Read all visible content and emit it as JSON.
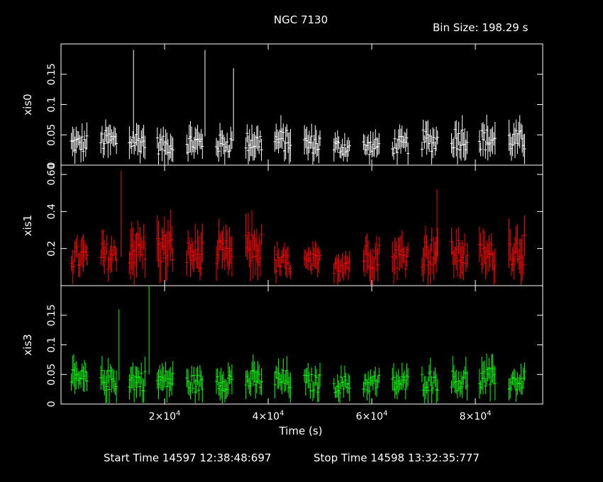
{
  "title": "NGC 7130",
  "bin_size_label": "Bin Size: 198.29 s",
  "footer": {
    "start_label": "Start Time 14597 12:38:48:697",
    "stop_label": "Stop Time 14598 13:32:35:777"
  },
  "chart_data": {
    "type": "line",
    "title": "NGC 7130",
    "xlabel": "Time (s)",
    "xlim": [
      0,
      93000
    ],
    "x_ticks": [
      {
        "value": 20000,
        "base": "2×10",
        "exp": "4"
      },
      {
        "value": 40000,
        "base": "4×10",
        "exp": "4"
      },
      {
        "value": 60000,
        "base": "6×10",
        "exp": "4"
      },
      {
        "value": 80000,
        "base": "8×10",
        "exp": "4"
      }
    ],
    "segment_starts": [
      2000,
      7700,
      13200,
      18600,
      24300,
      30000,
      35700,
      41300,
      47000,
      52700,
      58400,
      64000,
      69700,
      75400,
      80800,
      86500
    ],
    "segment_width": 3000,
    "series": [
      {
        "name": "xis0",
        "ylabel": "xis0",
        "color": "#ffffff",
        "ylim": [
          0,
          0.2
        ],
        "yticks": [
          0,
          0.05,
          0.1,
          0.15
        ],
        "ytick_labels": [
          "0",
          "0.05",
          "0.1",
          "0.15"
        ],
        "segment_means": [
          0.035,
          0.04,
          0.04,
          0.033,
          0.037,
          0.035,
          0.038,
          0.04,
          0.035,
          0.03,
          0.03,
          0.033,
          0.04,
          0.045,
          0.042,
          0.04
        ],
        "spikes": [
          {
            "x": 14000,
            "y": 0.19
          },
          {
            "x": 27800,
            "y": 0.19
          },
          {
            "x": 33300,
            "y": 0.16
          }
        ]
      },
      {
        "name": "xis1",
        "ylabel": "xis1",
        "color": "#ff0000",
        "ylim": [
          0,
          0.65
        ],
        "yticks": [
          0.2,
          0.4,
          0.6
        ],
        "ytick_labels": [
          "0.2",
          "0.4",
          "0.60"
        ],
        "segment_means": [
          0.15,
          0.16,
          0.2,
          0.2,
          0.17,
          0.17,
          0.2,
          0.12,
          0.12,
          0.12,
          0.16,
          0.16,
          0.18,
          0.17,
          0.16,
          0.2
        ],
        "spikes": [
          {
            "x": 11600,
            "y": 0.62
          },
          {
            "x": 72600,
            "y": 0.52
          }
        ]
      },
      {
        "name": "xis3",
        "ylabel": "xis3",
        "color": "#00ff00",
        "ylim": [
          0,
          0.2
        ],
        "yticks": [
          0,
          0.05,
          0.1,
          0.15
        ],
        "ytick_labels": [
          "0",
          "0.05",
          "0.1",
          "0.15"
        ],
        "segment_means": [
          0.04,
          0.04,
          0.04,
          0.04,
          0.035,
          0.04,
          0.04,
          0.04,
          0.035,
          0.033,
          0.035,
          0.035,
          0.04,
          0.04,
          0.042,
          0.038
        ],
        "spikes": [
          {
            "x": 11200,
            "y": 0.16
          },
          {
            "x": 17000,
            "y": 0.2
          }
        ]
      }
    ]
  }
}
